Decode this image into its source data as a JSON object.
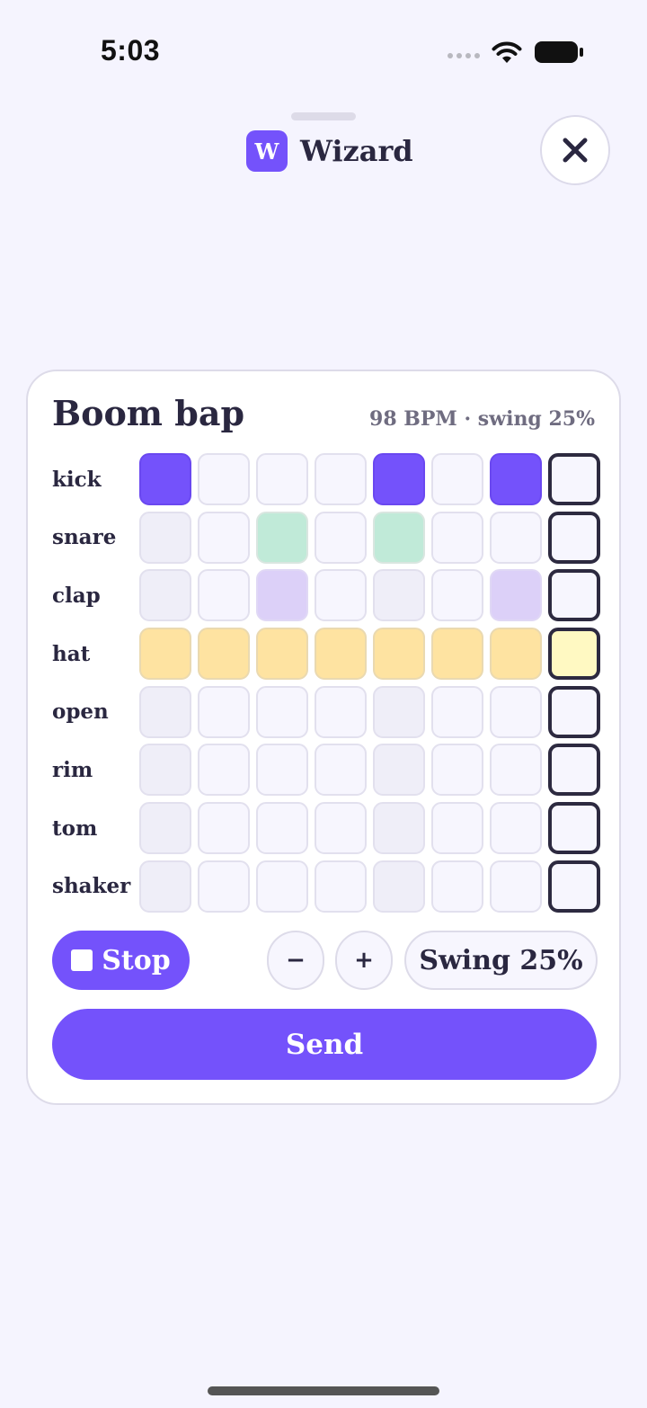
{
  "status_bar": {
    "time": "5:03"
  },
  "header": {
    "badge": "W",
    "title": "Wizard"
  },
  "card": {
    "title": "Boom bap",
    "meta": "98 BPM · swing 25%"
  },
  "sequencer": {
    "rows": [
      {
        "label": "kick",
        "style": "kick-on",
        "steps": [
          1,
          0,
          0,
          0,
          1,
          0,
          1,
          0
        ]
      },
      {
        "label": "snare",
        "style": "snare-on",
        "steps": [
          0,
          0,
          1,
          0,
          1,
          0,
          0,
          0
        ]
      },
      {
        "label": "clap",
        "style": "clap-on",
        "steps": [
          0,
          0,
          1,
          0,
          0,
          0,
          1,
          0
        ]
      },
      {
        "label": "hat",
        "style": "hat-on",
        "steps": [
          1,
          1,
          1,
          1,
          1,
          1,
          1,
          1
        ]
      },
      {
        "label": "open",
        "style": "hat-on",
        "steps": [
          0,
          0,
          0,
          0,
          0,
          0,
          0,
          0
        ]
      },
      {
        "label": "rim",
        "style": "hat-on",
        "steps": [
          0,
          0,
          0,
          0,
          0,
          0,
          0,
          0
        ]
      },
      {
        "label": "tom",
        "style": "hat-on",
        "steps": [
          0,
          0,
          0,
          0,
          0,
          0,
          0,
          0
        ]
      },
      {
        "label": "shaker",
        "style": "hat-on",
        "steps": [
          0,
          0,
          0,
          0,
          0,
          0,
          0,
          0
        ]
      }
    ],
    "current_step": 8,
    "steps_per_row": 8
  },
  "controls": {
    "stop_label": "Stop",
    "minus_label": "−",
    "plus_label": "+",
    "swing_label": "Swing 25%",
    "send_label": "Send"
  }
}
